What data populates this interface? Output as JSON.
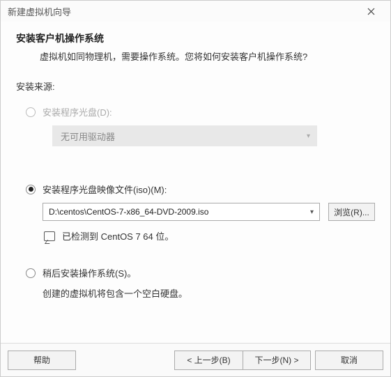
{
  "window": {
    "title": "新建虚拟机向导"
  },
  "header": {
    "heading": "安装客户机操作系统",
    "subheading": "虚拟机如同物理机，需要操作系统。您将如何安装客户机操作系统?"
  },
  "source": {
    "label": "安装来源:",
    "opt_disc": {
      "label": "安装程序光盘(D):",
      "dropdown": "无可用驱动器"
    },
    "opt_iso": {
      "label": "安装程序光盘映像文件(iso)(M):",
      "path": "D:\\centos\\CentOS-7-x86_64-DVD-2009.iso",
      "browse": "浏览(R)...",
      "detected": "已检测到 CentOS 7 64 位。"
    },
    "opt_later": {
      "label": "稍后安装操作系统(S)。",
      "hint": "创建的虚拟机将包含一个空白硬盘。"
    }
  },
  "footer": {
    "help": "帮助",
    "back": "< 上一步(B)",
    "next": "下一步(N) >",
    "cancel": "取消"
  }
}
